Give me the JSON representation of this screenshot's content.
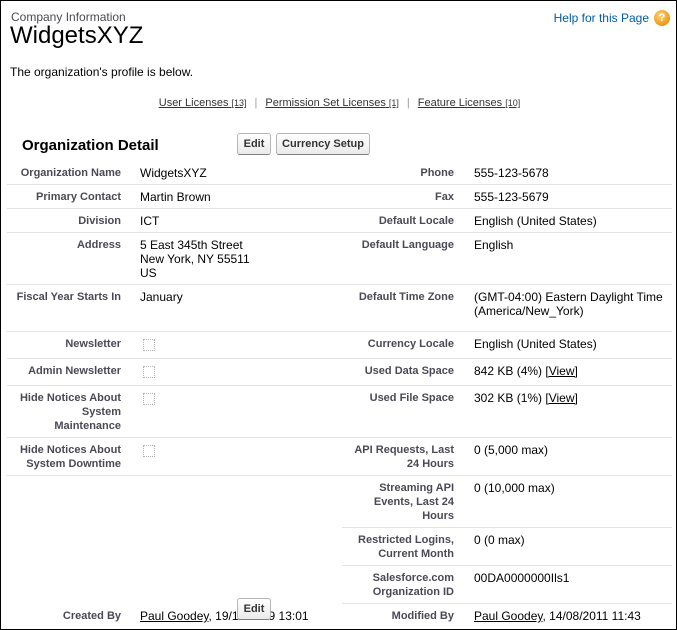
{
  "header": {
    "breadcrumb": "Company Information",
    "title": "WidgetsXYZ",
    "help_label": "Help for this Page",
    "help_icon": "question-circle-icon",
    "intro": "The organization's profile is below."
  },
  "license_links": [
    {
      "label": "User Licenses",
      "count": "[13]"
    },
    {
      "label": "Permission Set Licenses",
      "count": "[1]"
    },
    {
      "label": "Feature Licenses",
      "count": "[10]"
    }
  ],
  "license_separator": "|",
  "section": {
    "title": "Organization Detail",
    "edit_label": "Edit",
    "currency_setup_label": "Currency Setup",
    "bottom_edit_label": "Edit"
  },
  "rows": [
    {
      "l_label": "Organization Name",
      "l_value": "WidgetsXYZ",
      "r_label": "Phone",
      "r_value": "555-123-5678"
    },
    {
      "l_label": "Primary Contact",
      "l_value": "Martin Brown",
      "r_label": "Fax",
      "r_value": "555-123-5679"
    },
    {
      "l_label": "Division",
      "l_value": "ICT",
      "r_label": "Default Locale",
      "r_value": "English (United States)"
    },
    {
      "l_label": "Address",
      "l_value_lines": [
        "5 East 345th Street",
        "New York, NY 55511",
        "US"
      ],
      "r_label": "Default Language",
      "r_value": "English"
    },
    {
      "l_label": "Fiscal Year Starts In",
      "l_value": "January",
      "r_label": "Default Time Zone",
      "r_value_lines": [
        "(GMT-04:00) Eastern Daylight Time",
        "(America/New_York)"
      ]
    },
    {
      "l_label": "Newsletter",
      "l_checkbox": false,
      "r_label": "Currency Locale",
      "r_value": "English (United States)"
    },
    {
      "l_label": "Admin Newsletter",
      "l_checkbox": false,
      "r_label": "Used Data Space",
      "r_value": "842 KB (4%)",
      "r_link": "[View]"
    },
    {
      "l_label_lines": [
        "Hide Notices About",
        "System",
        "Maintenance"
      ],
      "l_checkbox": false,
      "r_label": "Used File Space",
      "r_value": "302 KB (1%)",
      "r_link": "[View]"
    },
    {
      "l_label_lines": [
        "Hide Notices About",
        "System Downtime"
      ],
      "l_checkbox": false,
      "r_label_lines": [
        "API Requests, Last",
        "24 Hours"
      ],
      "r_value": "0 (5,000 max)"
    },
    {
      "r_label_lines": [
        "Streaming API",
        "Events, Last 24",
        "Hours"
      ],
      "r_value": "0 (10,000 max)"
    },
    {
      "r_label_lines": [
        "Restricted Logins,",
        "Current Month"
      ],
      "r_value": "0 (0 max)"
    },
    {
      "r_label_lines": [
        "Salesforce.com",
        "Organization ID"
      ],
      "r_value": "00DA0000000Ils1"
    },
    {
      "l_label": "Created By",
      "l_link": "Paul Goodey",
      "l_value": ", 19/12/2009 13:01",
      "r_label": "Modified By",
      "r_link": "Paul Goodey",
      "r_value": ", 14/08/2011 11:43"
    }
  ]
}
